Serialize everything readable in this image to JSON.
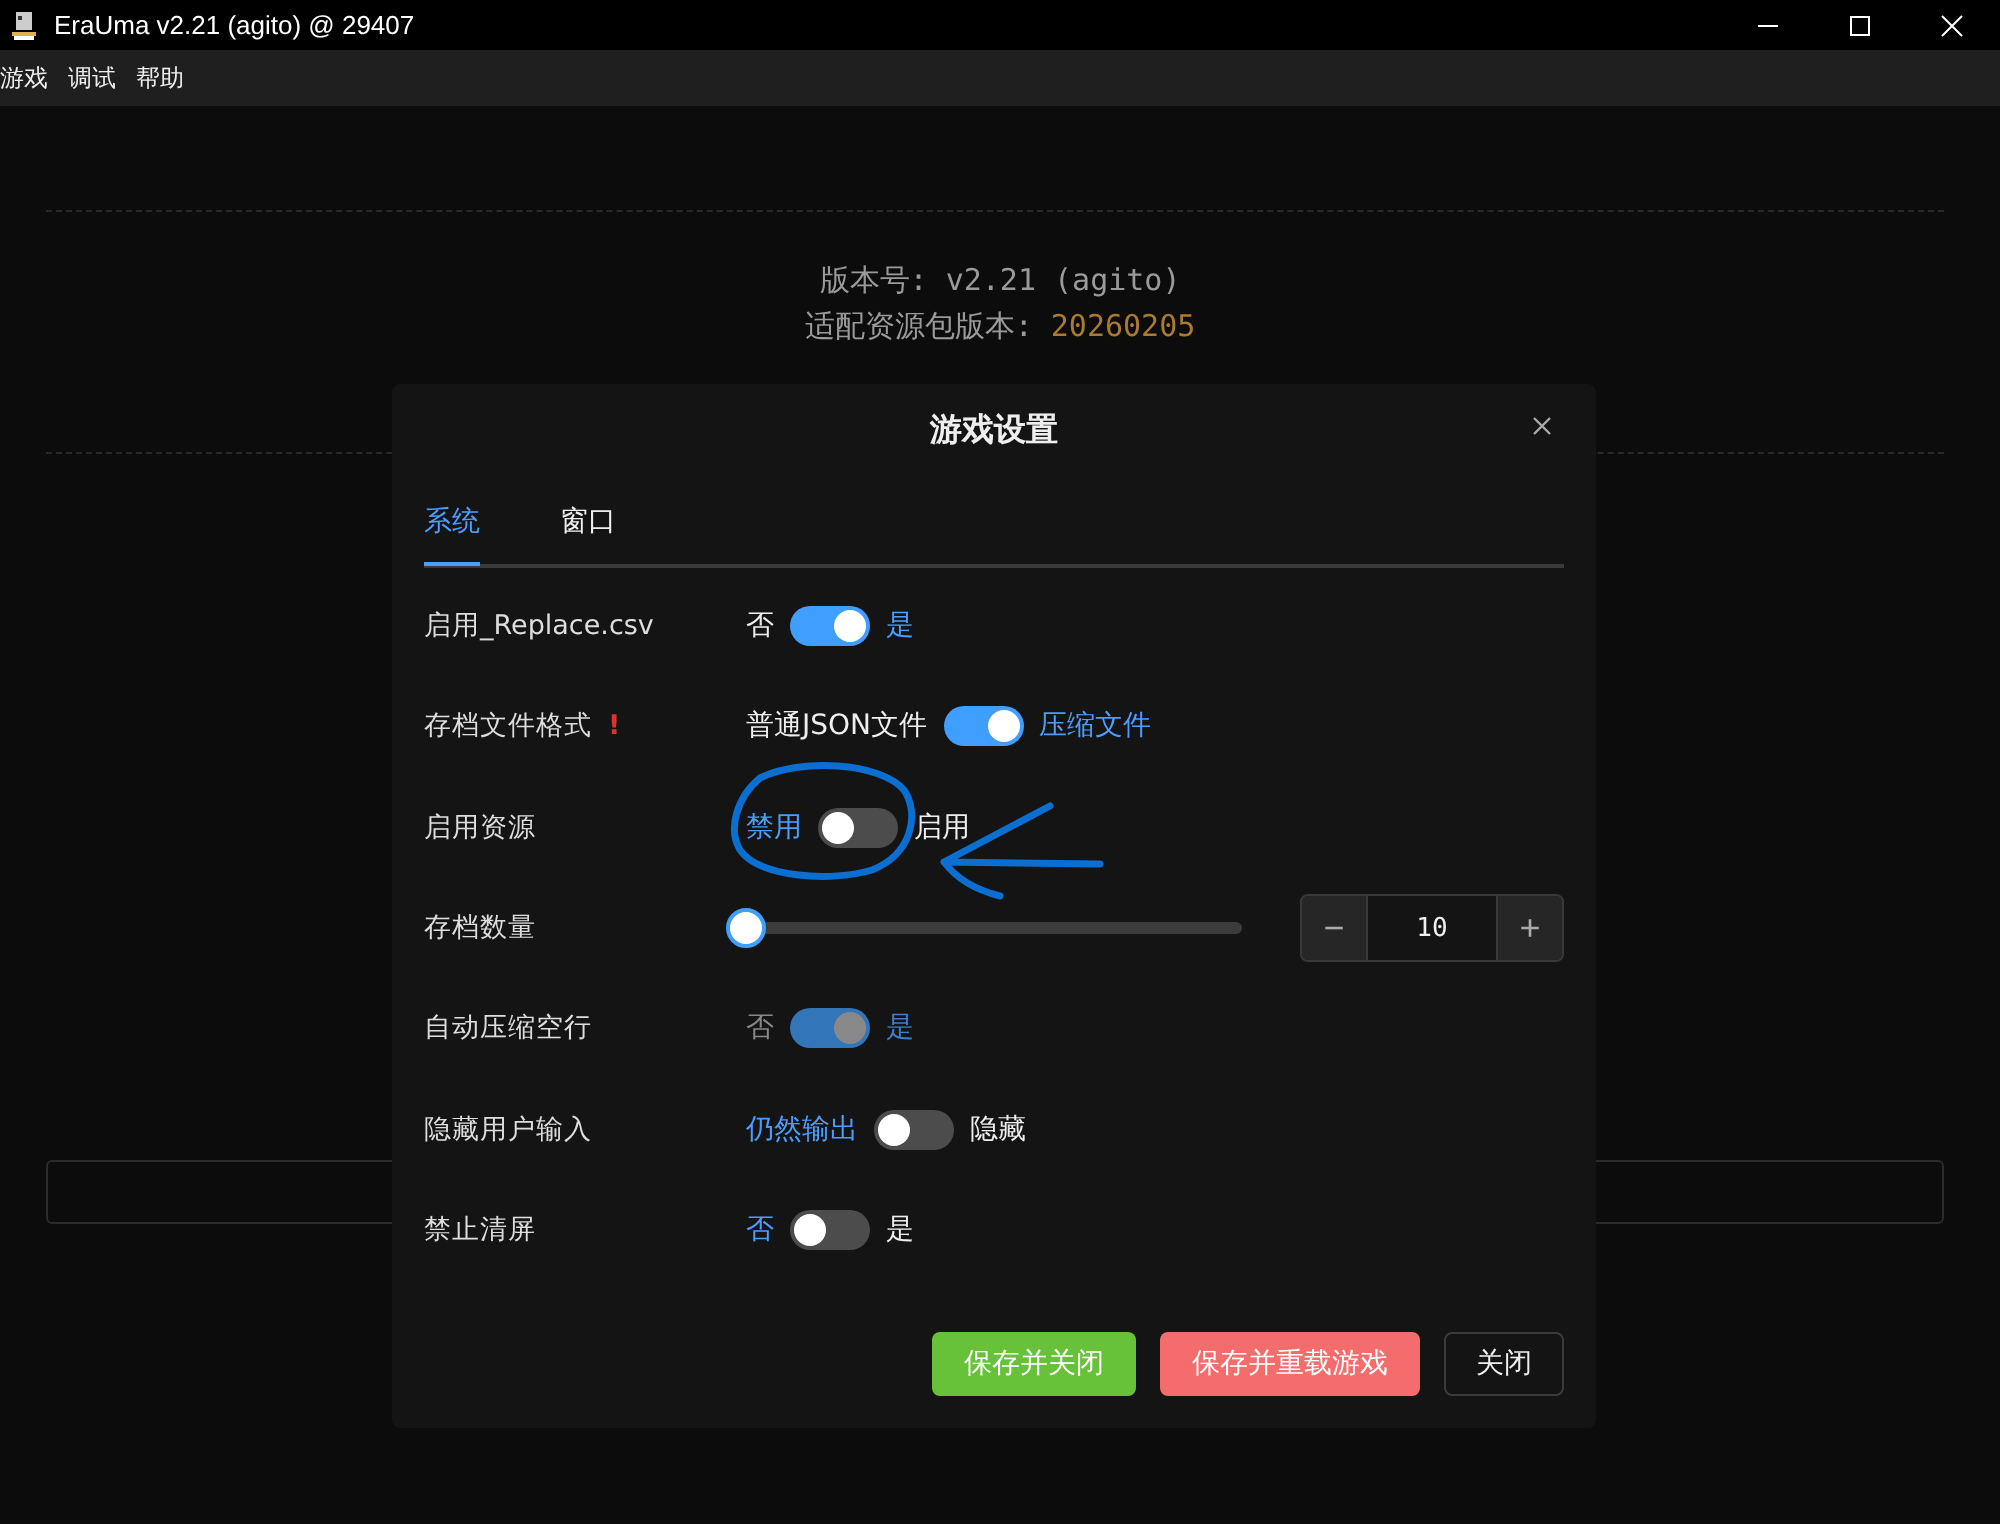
{
  "window": {
    "title": "EraUma v2.21 (agito) @ 29407"
  },
  "menu": [
    "游戏",
    "调试",
    "帮助"
  ],
  "background": {
    "version": "版本号: v2.21 (agito)",
    "resource_label": "适配资源包版本: ",
    "resource_version": "20260205"
  },
  "dialog": {
    "title": "游戏设置",
    "tabs": [
      {
        "label": "系统",
        "selected": true
      },
      {
        "label": "窗口",
        "selected": false
      }
    ],
    "settings": [
      {
        "kind": "switch",
        "label": "启用_Replace.csv",
        "off_label": "否",
        "on_label": "是",
        "on": true,
        "disabled": false
      },
      {
        "kind": "switch",
        "label": "存档文件格式",
        "warning": "!",
        "off_label": "普通JSON文件",
        "on_label": "压缩文件",
        "on": true,
        "disabled": false
      },
      {
        "kind": "switch",
        "label": "启用资源",
        "off_label": "禁用",
        "on_label": "启用",
        "on": false,
        "disabled": false
      },
      {
        "kind": "slider",
        "label": "存档数量",
        "level": 0,
        "value": "10",
        "decrement": "−",
        "increment": "+"
      },
      {
        "kind": "switch",
        "label": "自动压缩空行",
        "off_label": "否",
        "on_label": "是",
        "on": true,
        "disabled": true
      },
      {
        "kind": "switch",
        "label": "隐藏用户输入",
        "off_label": "仍然输出",
        "on_label": "隐藏",
        "on": false,
        "disabled": false
      },
      {
        "kind": "switch",
        "label": "禁止清屏",
        "off_label": "否",
        "on_label": "是",
        "on": false,
        "disabled": false
      }
    ],
    "buttons": [
      {
        "label": "保存并关闭",
        "kind": "success"
      },
      {
        "label": "保存并重载游戏",
        "kind": "danger"
      },
      {
        "label": "关闭",
        "kind": "plain"
      }
    ]
  }
}
